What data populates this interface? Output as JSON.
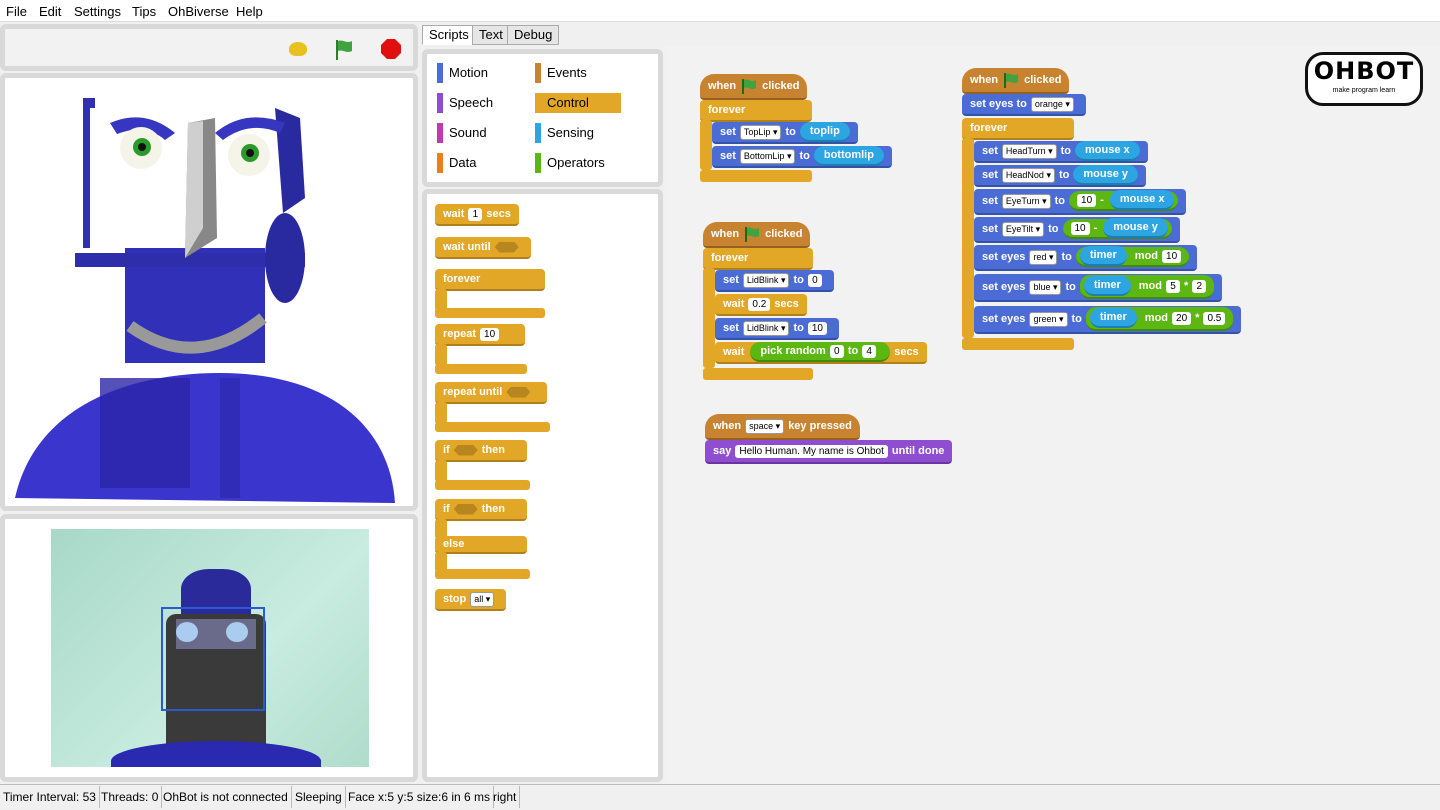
{
  "menu": [
    "File",
    "Edit",
    "Settings",
    "Tips",
    "OhBiverse",
    "Help"
  ],
  "tabs": [
    "Scripts",
    "Text",
    "Debug"
  ],
  "categories": {
    "motion": "Motion",
    "events": "Events",
    "speech": "Speech",
    "control": "Control",
    "sound": "Sound",
    "sensing": "Sensing",
    "data": "Data",
    "operators": "Operators"
  },
  "palette": {
    "wait": "wait",
    "wait_val": "1",
    "secs": "secs",
    "wait_until": "wait until",
    "forever": "forever",
    "repeat": "repeat",
    "repeat_val": "10",
    "repeat_until": "repeat until",
    "if": "if",
    "then": "then",
    "else": "else",
    "stop": "stop",
    "stop_val": "all"
  },
  "logo": {
    "text": "OHBOT",
    "tagline": "make program learn"
  },
  "scripts": {
    "s1": {
      "when": "when",
      "clicked": "clicked",
      "forever": "forever",
      "set": "set",
      "to": "to",
      "toplip": "TopLip",
      "toplip_r": "toplip",
      "bottomlip": "BottomLip",
      "bottomlip_r": "bottomlip"
    },
    "s2": {
      "when": "when",
      "clicked": "clicked",
      "forever": "forever",
      "set": "set",
      "to": "to",
      "lidblink": "LidBlink",
      "v0": "0",
      "wait": "wait",
      "wv": "0.2",
      "secs": "secs",
      "v10": "10",
      "pick": "pick random",
      "to2": "to",
      "r0": "0",
      "r4": "4"
    },
    "s3": {
      "when": "when",
      "key": "space",
      "pressed": "key pressed",
      "say": "say",
      "msg": "Hello Human.  My name is Ohbot",
      "until": "until done"
    },
    "s4": {
      "when": "when",
      "clicked": "clicked",
      "set_eyes": "set eyes to",
      "orange": "orange",
      "forever": "forever",
      "set": "set",
      "to": "to",
      "headturn": "HeadTurn",
      "mousex": "mouse x",
      "headnod": "HeadNod",
      "mousey": "mouse y",
      "eyeturn": "EyeTurn",
      "ten": "10",
      "minus": "-",
      "eyetilt": "EyeTilt",
      "set_eyes2": "set eyes",
      "red": "red",
      "timer": "timer",
      "mod": "mod",
      "m10": "10",
      "blue": "blue",
      "m5": "5",
      "times": "*",
      "m2": "2",
      "green": "green",
      "m20": "20",
      "m05": "0.5"
    }
  },
  "status": [
    "Timer Interval: 53",
    "Threads: 0",
    "OhBot is not connected",
    "Sleeping",
    "Face x:5 y:5 size:6 in 6 ms",
    "right"
  ],
  "colors": {
    "control": "#e2a726",
    "events": "#c88330",
    "motion": "#4a6cd4",
    "operators": "#5cb712",
    "sensing": "#2ca5e2",
    "looks": "#8e4ecf",
    "robot_blue": "#3333cc"
  }
}
